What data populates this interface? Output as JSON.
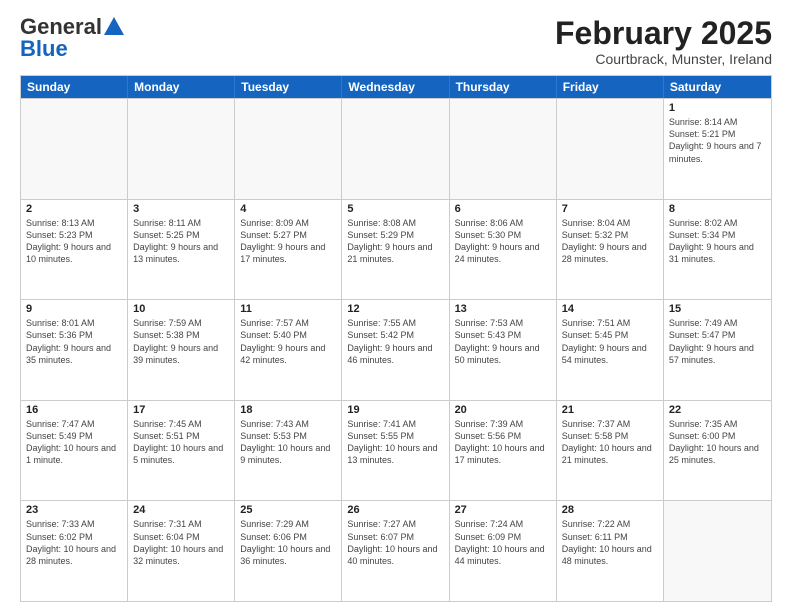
{
  "header": {
    "logo": {
      "line1": "General",
      "line2": "Blue"
    },
    "title": "February 2025",
    "subtitle": "Courtbrack, Munster, Ireland"
  },
  "days_of_week": [
    "Sunday",
    "Monday",
    "Tuesday",
    "Wednesday",
    "Thursday",
    "Friday",
    "Saturday"
  ],
  "weeks": [
    [
      {
        "day": "",
        "info": ""
      },
      {
        "day": "",
        "info": ""
      },
      {
        "day": "",
        "info": ""
      },
      {
        "day": "",
        "info": ""
      },
      {
        "day": "",
        "info": ""
      },
      {
        "day": "",
        "info": ""
      },
      {
        "day": "1",
        "info": "Sunrise: 8:14 AM\nSunset: 5:21 PM\nDaylight: 9 hours and 7 minutes."
      }
    ],
    [
      {
        "day": "2",
        "info": "Sunrise: 8:13 AM\nSunset: 5:23 PM\nDaylight: 9 hours and 10 minutes."
      },
      {
        "day": "3",
        "info": "Sunrise: 8:11 AM\nSunset: 5:25 PM\nDaylight: 9 hours and 13 minutes."
      },
      {
        "day": "4",
        "info": "Sunrise: 8:09 AM\nSunset: 5:27 PM\nDaylight: 9 hours and 17 minutes."
      },
      {
        "day": "5",
        "info": "Sunrise: 8:08 AM\nSunset: 5:29 PM\nDaylight: 9 hours and 21 minutes."
      },
      {
        "day": "6",
        "info": "Sunrise: 8:06 AM\nSunset: 5:30 PM\nDaylight: 9 hours and 24 minutes."
      },
      {
        "day": "7",
        "info": "Sunrise: 8:04 AM\nSunset: 5:32 PM\nDaylight: 9 hours and 28 minutes."
      },
      {
        "day": "8",
        "info": "Sunrise: 8:02 AM\nSunset: 5:34 PM\nDaylight: 9 hours and 31 minutes."
      }
    ],
    [
      {
        "day": "9",
        "info": "Sunrise: 8:01 AM\nSunset: 5:36 PM\nDaylight: 9 hours and 35 minutes."
      },
      {
        "day": "10",
        "info": "Sunrise: 7:59 AM\nSunset: 5:38 PM\nDaylight: 9 hours and 39 minutes."
      },
      {
        "day": "11",
        "info": "Sunrise: 7:57 AM\nSunset: 5:40 PM\nDaylight: 9 hours and 42 minutes."
      },
      {
        "day": "12",
        "info": "Sunrise: 7:55 AM\nSunset: 5:42 PM\nDaylight: 9 hours and 46 minutes."
      },
      {
        "day": "13",
        "info": "Sunrise: 7:53 AM\nSunset: 5:43 PM\nDaylight: 9 hours and 50 minutes."
      },
      {
        "day": "14",
        "info": "Sunrise: 7:51 AM\nSunset: 5:45 PM\nDaylight: 9 hours and 54 minutes."
      },
      {
        "day": "15",
        "info": "Sunrise: 7:49 AM\nSunset: 5:47 PM\nDaylight: 9 hours and 57 minutes."
      }
    ],
    [
      {
        "day": "16",
        "info": "Sunrise: 7:47 AM\nSunset: 5:49 PM\nDaylight: 10 hours and 1 minute."
      },
      {
        "day": "17",
        "info": "Sunrise: 7:45 AM\nSunset: 5:51 PM\nDaylight: 10 hours and 5 minutes."
      },
      {
        "day": "18",
        "info": "Sunrise: 7:43 AM\nSunset: 5:53 PM\nDaylight: 10 hours and 9 minutes."
      },
      {
        "day": "19",
        "info": "Sunrise: 7:41 AM\nSunset: 5:55 PM\nDaylight: 10 hours and 13 minutes."
      },
      {
        "day": "20",
        "info": "Sunrise: 7:39 AM\nSunset: 5:56 PM\nDaylight: 10 hours and 17 minutes."
      },
      {
        "day": "21",
        "info": "Sunrise: 7:37 AM\nSunset: 5:58 PM\nDaylight: 10 hours and 21 minutes."
      },
      {
        "day": "22",
        "info": "Sunrise: 7:35 AM\nSunset: 6:00 PM\nDaylight: 10 hours and 25 minutes."
      }
    ],
    [
      {
        "day": "23",
        "info": "Sunrise: 7:33 AM\nSunset: 6:02 PM\nDaylight: 10 hours and 28 minutes."
      },
      {
        "day": "24",
        "info": "Sunrise: 7:31 AM\nSunset: 6:04 PM\nDaylight: 10 hours and 32 minutes."
      },
      {
        "day": "25",
        "info": "Sunrise: 7:29 AM\nSunset: 6:06 PM\nDaylight: 10 hours and 36 minutes."
      },
      {
        "day": "26",
        "info": "Sunrise: 7:27 AM\nSunset: 6:07 PM\nDaylight: 10 hours and 40 minutes."
      },
      {
        "day": "27",
        "info": "Sunrise: 7:24 AM\nSunset: 6:09 PM\nDaylight: 10 hours and 44 minutes."
      },
      {
        "day": "28",
        "info": "Sunrise: 7:22 AM\nSunset: 6:11 PM\nDaylight: 10 hours and 48 minutes."
      },
      {
        "day": "",
        "info": ""
      }
    ]
  ]
}
